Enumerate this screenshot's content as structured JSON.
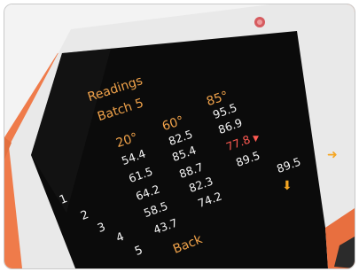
{
  "screen": {
    "title_line1": "Readings",
    "title_line2": "Batch 5",
    "columns": [
      "20°",
      "60°",
      "85°"
    ],
    "rows": [
      {
        "label": "1",
        "values": [
          "54.4",
          "82.5",
          "95.5"
        ]
      },
      {
        "label": "2",
        "values": [
          "61.5",
          "85.4",
          "86.9"
        ]
      },
      {
        "label": "3",
        "values": [
          "64.2",
          "88.7",
          "77.8"
        ]
      },
      {
        "label": "4",
        "values": [
          "58.5",
          "82.3",
          "89.5"
        ]
      },
      {
        "label": "5",
        "values": [
          "43.7",
          "74.2",
          "89.5"
        ]
      }
    ],
    "warning_mark": "▼",
    "arrow_right": "➜",
    "arrow_down": "⬇",
    "back_label": "Back"
  },
  "colors": {
    "device_body": "#f07a4a",
    "screen_bg": "#0b0b0b",
    "accent_text": "#f0a24a",
    "warning_text": "#ff5a52",
    "value_text": "#f4f4f4"
  }
}
